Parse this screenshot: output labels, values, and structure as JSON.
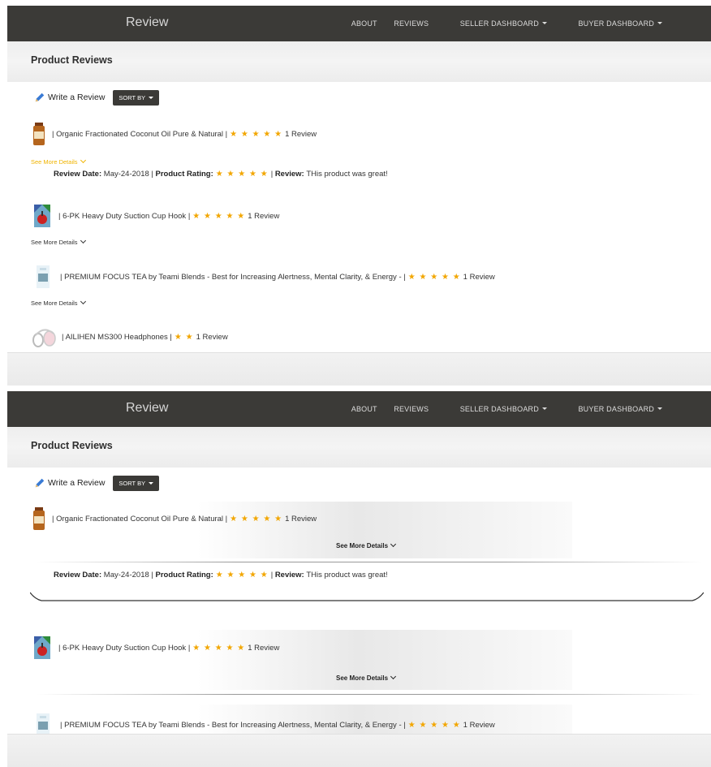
{
  "nav": {
    "brand": "Review",
    "links": [
      "ABOUT",
      "REVIEWS",
      "SELLER DASHBOARD",
      "BUYER DASHBOARD"
    ]
  },
  "page": {
    "title": "Product Reviews",
    "write_review": "Write a Review",
    "sort_by": "SORT BY",
    "see_more": "See More Details",
    "review_count": "1 Review"
  },
  "products": [
    {
      "name": "| Organic Fractionated Coconut Oil Pure & Natural |",
      "stars": "★ ★ ★ ★ ★",
      "review": "1 Review"
    },
    {
      "name": "| 6-PK Heavy Duty Suction Cup Hook |",
      "stars": "★ ★ ★ ★ ★",
      "review": "1 Review"
    },
    {
      "name": "| PREMIUM FOCUS TEA by Teami Blends - Best for Increasing Alertness, Mental Clarity, & Energy - |",
      "stars": "★ ★ ★ ★ ★",
      "review": "1 Review"
    },
    {
      "name": "| AILIHEN MS300 Headphones |",
      "stars": "★ ★",
      "review": "1 Review"
    }
  ],
  "review": {
    "date_label": "Review Date:",
    "date": "May-24-2018",
    "sep1": "|",
    "rating_label": "Product Rating:",
    "stars": "★ ★ ★ ★ ★",
    "sep2": "|",
    "review_label": "Review:",
    "text": "THis product was great!"
  },
  "colors": {
    "navbar": "#3b3a37",
    "star": "#f2a600",
    "see_more_highlight": "#f0b400"
  },
  "icons": {
    "write": "pencil-icon",
    "dropdown": "caret-down-icon",
    "expand": "chevron-down-icon"
  }
}
